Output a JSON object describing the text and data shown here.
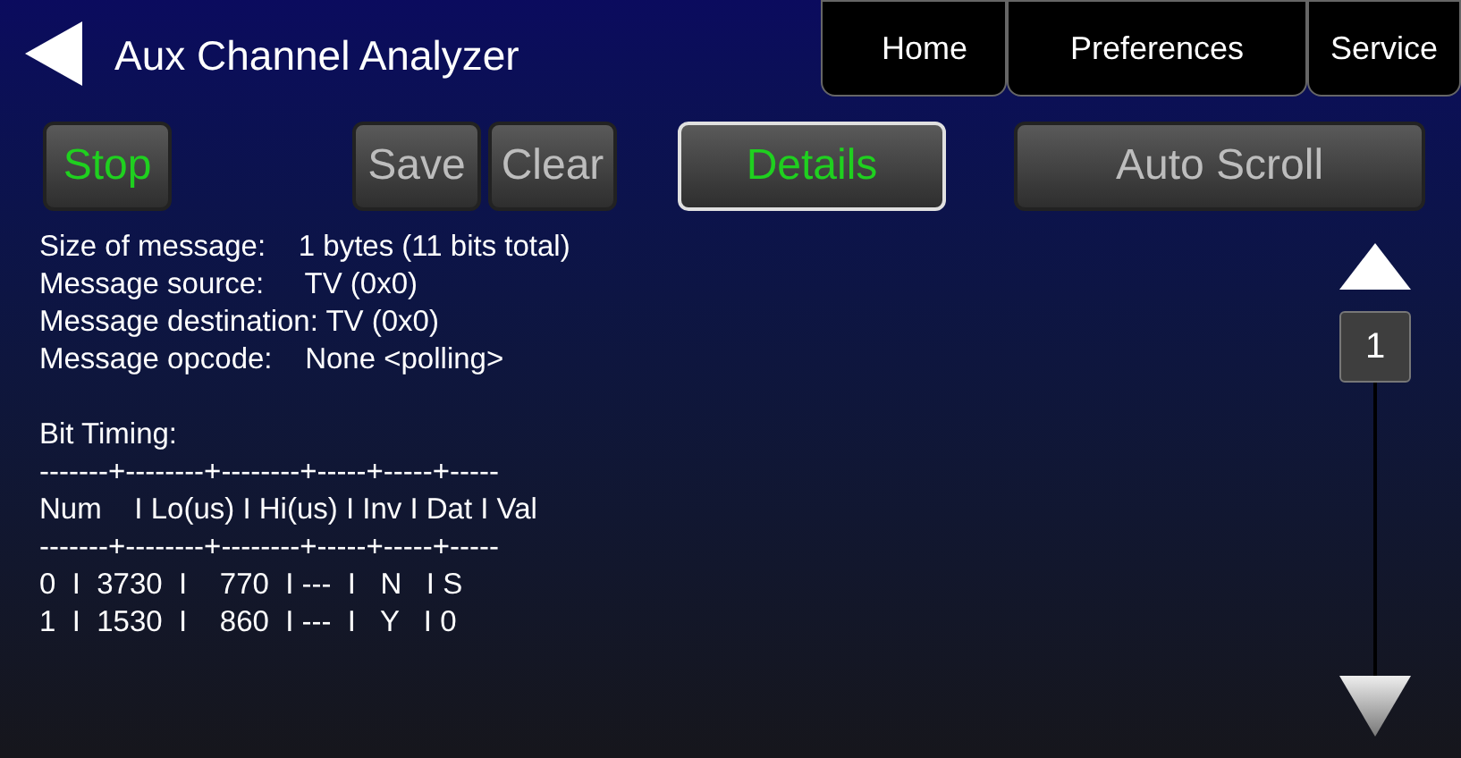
{
  "header": {
    "title": "Aux Channel Analyzer"
  },
  "tabs": [
    {
      "label": "Home",
      "selected": false
    },
    {
      "label": "Preferences",
      "selected": false
    },
    {
      "label": "Service",
      "selected": false
    }
  ],
  "toolbar": [
    {
      "label": "Stop",
      "on": true,
      "selected": false
    },
    {
      "label": "Save",
      "on": false,
      "selected": false
    },
    {
      "label": "Clear",
      "on": false,
      "selected": false
    },
    {
      "label": "Details",
      "on": true,
      "selected": true
    },
    {
      "label": "Auto Scroll",
      "on": false,
      "selected": false
    }
  ],
  "message_info": [
    "Size of message:    1 bytes (11 bits total)",
    "Message source:     TV (0x0)",
    "Message destination: TV (0x0)",
    "Message opcode:    None <polling>"
  ],
  "bit_timing": {
    "title": "Bit Timing:",
    "lines": [
      "-------+--------+--------+-----+-----+-----",
      "Num    I Lo(us) I Hi(us) I Inv I Dat I Val",
      "-------+--------+--------+-----+-----+-----",
      "0  I  3730  I    770  I ---  I   N   I S",
      "1  I  1530  I    860  I ---  I   Y   I 0"
    ]
  },
  "scroller": {
    "page": "1"
  }
}
